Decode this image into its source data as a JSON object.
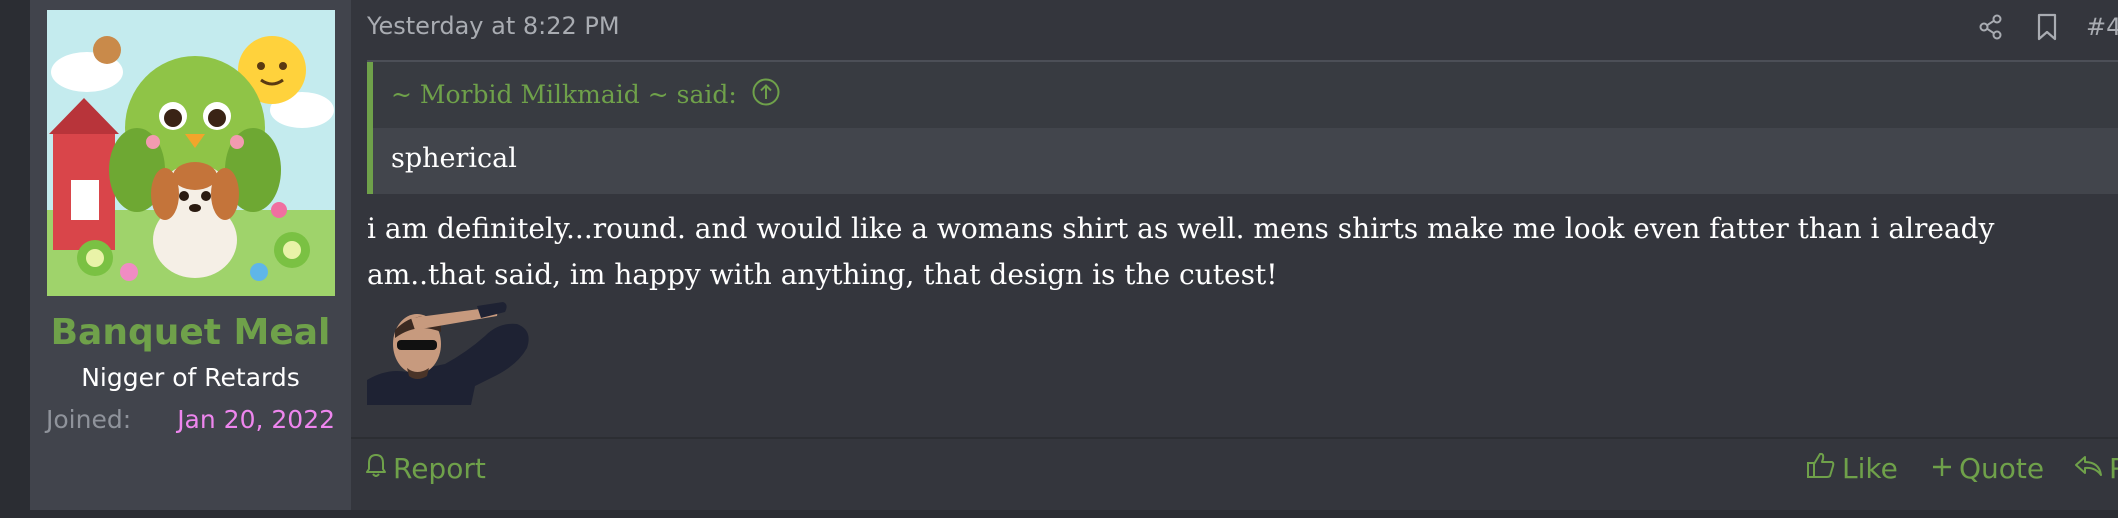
{
  "post": {
    "user": {
      "username": "Banquet Meal",
      "title": "Nigger of Retards",
      "joined_label": "Joined:",
      "joined_date": "Jan 20, 2022",
      "avatar_icon": "cartoon-bird-and-puppy-avatar",
      "username_color": "#6fa14a",
      "joined_date_color": "#ee86ee"
    },
    "header": {
      "date": "Yesterday at 8:22 PM",
      "share_icon": "share-icon",
      "bookmark_icon": "bookmark-icon",
      "post_number": "#4"
    },
    "quote": {
      "author_line": "~ Morbid Milkmaid ~ said:",
      "jump_icon": "arrow-up-circle-icon",
      "text": "spherical"
    },
    "message": {
      "text": "i am definitely...round. and would like a womans shirt as well. mens shirts make me look even fatter than i already am..that said, im happy with anything, that design is the cutest!",
      "image_icon": "saluting-man-sunglasses-meme"
    },
    "footer": {
      "report_label": "Report",
      "like_label": "Like",
      "quote_label": "Quote",
      "reply_label": "Reply",
      "accent_color": "#6fa14a"
    }
  }
}
